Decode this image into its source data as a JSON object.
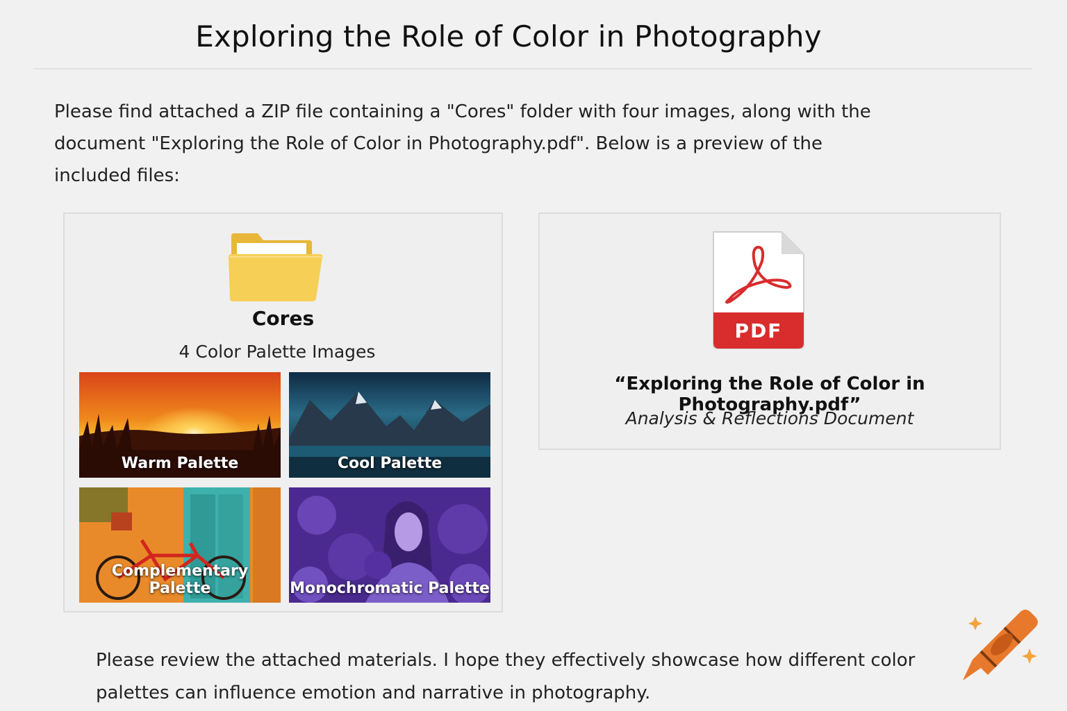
{
  "title": "Exploring the Role of Color in Photography",
  "intro": {
    "line1": "Please find attached a ZIP file containing a \"Cores\" folder with four images, along with the",
    "line2": "document \"Exploring the Role of Color in Photography.pdf\". Below is a preview of the",
    "line3": "included files:"
  },
  "folder": {
    "name": "Cores",
    "description": "4 Color Palette Images",
    "icon": "folder-icon",
    "images": [
      {
        "label": "Warm Palette"
      },
      {
        "label": "Cool Palette"
      },
      {
        "label": "Complementary Palette"
      },
      {
        "label": "Monochromatic Palette"
      }
    ]
  },
  "pdf": {
    "icon": "pdf-icon",
    "badge": "PDF",
    "name": "“Exploring the Role of Color in Photography.pdf”",
    "description": "Analysis & Reflections Document"
  },
  "outro": {
    "line1": "Please review the attached materials. I hope they effectively showcase how different color",
    "line2": "palettes can influence emotion and narrative in photography."
  },
  "colors": {
    "pdf_red": "#d92c2c",
    "folder_yellow": "#f3c94a",
    "crayon_orange": "#e8792c"
  }
}
